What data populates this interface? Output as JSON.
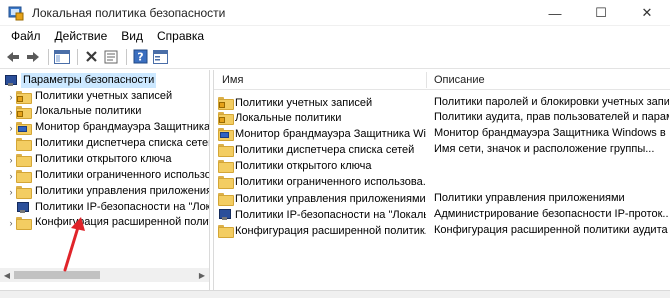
{
  "window": {
    "title": "Локальная политика безопасности",
    "minimize": "—",
    "maximize": "☐",
    "close": "✕"
  },
  "menu": [
    {
      "label": "Файл"
    },
    {
      "label": "Действие"
    },
    {
      "label": "Вид"
    },
    {
      "label": "Справка"
    }
  ],
  "toolbar": {
    "icons": [
      "back-arrow-icon",
      "forward-arrow-icon",
      "console-tree-icon",
      "delete-icon",
      "properties-icon",
      "help-icon",
      "export-list-icon"
    ]
  },
  "tree": {
    "root": {
      "label": "Параметры безопасности"
    },
    "items": [
      {
        "label": "Политики учетных записей",
        "icon": "folder-lock"
      },
      {
        "label": "Локальные политики",
        "icon": "folder-lock"
      },
      {
        "label": "Монитор брандмауэра Защитника W",
        "icon": "folder-monitor"
      },
      {
        "label": "Политики диспетчера списка сетей",
        "icon": "folder"
      },
      {
        "label": "Политики открытого ключа",
        "icon": "folder"
      },
      {
        "label": "Политики ограниченного использо",
        "icon": "folder"
      },
      {
        "label": "Политики управления приложения",
        "icon": "folder"
      },
      {
        "label": "Политики IP-безопасности на \"Лока",
        "icon": "shield"
      },
      {
        "label": "Конфигурация расширенной полити",
        "icon": "folder"
      }
    ]
  },
  "list": {
    "columns": [
      "Имя",
      "Описание"
    ],
    "rows": [
      {
        "name": "Политики учетных записей",
        "desc": "Политики паролей и блокировки учетных записей",
        "icon": "folder-lock"
      },
      {
        "name": "Локальные политики",
        "desc": "Политики аудита, прав пользователей и параметро...",
        "icon": "folder-lock"
      },
      {
        "name": "Монитор брандмауэра Защитника Win...",
        "desc": "Монитор брандмауэра Защитника Windows в ре...",
        "icon": "folder-monitor"
      },
      {
        "name": "Политики диспетчера списка сетей",
        "desc": "Имя сети, значок и расположение группы...",
        "icon": "folder"
      },
      {
        "name": "Политики открытого ключа",
        "desc": "",
        "icon": "folder"
      },
      {
        "name": "Политики ограниченного использова...",
        "desc": "",
        "icon": "folder"
      },
      {
        "name": "Политики управления приложениями",
        "desc": "Политики управления приложениями",
        "icon": "folder"
      },
      {
        "name": "Политики IP-безопасности на \"Локаль...",
        "desc": "Администрирование безопасности IP-проток...",
        "icon": "shield"
      },
      {
        "name": "Конфигурация расширенной политик...",
        "desc": "Конфигурация расширенной политики аудита",
        "icon": "folder"
      }
    ]
  },
  "colors": {
    "selection": "#cce8ff",
    "folder": "#f3cd62",
    "annotation_arrow": "#e0242a"
  }
}
